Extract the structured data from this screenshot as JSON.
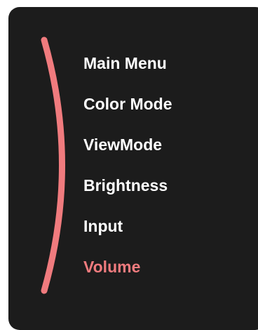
{
  "osd_menu": {
    "items": [
      {
        "label": "Main Menu",
        "selected": false
      },
      {
        "label": "Color Mode",
        "selected": false
      },
      {
        "label": "ViewMode",
        "selected": false
      },
      {
        "label": "Brightness",
        "selected": false
      },
      {
        "label": "Input",
        "selected": false
      },
      {
        "label": "Volume",
        "selected": true
      }
    ]
  },
  "colors": {
    "panel_background": "#1c1c1c",
    "text": "#ffffff",
    "accent": "#f07b7e"
  },
  "icons": [
    "menu-arc-indicator"
  ]
}
